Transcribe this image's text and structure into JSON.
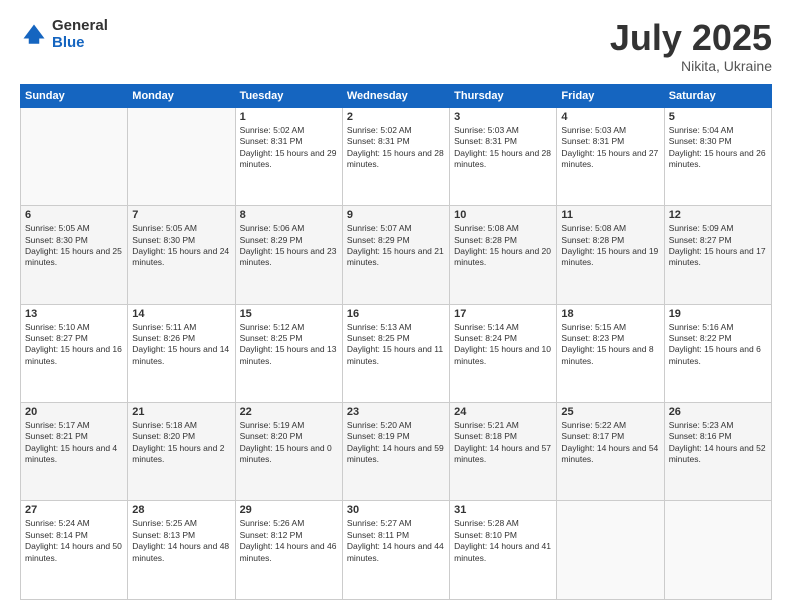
{
  "logo": {
    "general": "General",
    "blue": "Blue"
  },
  "header": {
    "month": "July 2025",
    "location": "Nikita, Ukraine"
  },
  "weekdays": [
    "Sunday",
    "Monday",
    "Tuesday",
    "Wednesday",
    "Thursday",
    "Friday",
    "Saturday"
  ],
  "weeks": [
    [
      {
        "day": "",
        "info": ""
      },
      {
        "day": "",
        "info": ""
      },
      {
        "day": "1",
        "info": "Sunrise: 5:02 AM\nSunset: 8:31 PM\nDaylight: 15 hours and 29 minutes."
      },
      {
        "day": "2",
        "info": "Sunrise: 5:02 AM\nSunset: 8:31 PM\nDaylight: 15 hours and 28 minutes."
      },
      {
        "day": "3",
        "info": "Sunrise: 5:03 AM\nSunset: 8:31 PM\nDaylight: 15 hours and 28 minutes."
      },
      {
        "day": "4",
        "info": "Sunrise: 5:03 AM\nSunset: 8:31 PM\nDaylight: 15 hours and 27 minutes."
      },
      {
        "day": "5",
        "info": "Sunrise: 5:04 AM\nSunset: 8:30 PM\nDaylight: 15 hours and 26 minutes."
      }
    ],
    [
      {
        "day": "6",
        "info": "Sunrise: 5:05 AM\nSunset: 8:30 PM\nDaylight: 15 hours and 25 minutes."
      },
      {
        "day": "7",
        "info": "Sunrise: 5:05 AM\nSunset: 8:30 PM\nDaylight: 15 hours and 24 minutes."
      },
      {
        "day": "8",
        "info": "Sunrise: 5:06 AM\nSunset: 8:29 PM\nDaylight: 15 hours and 23 minutes."
      },
      {
        "day": "9",
        "info": "Sunrise: 5:07 AM\nSunset: 8:29 PM\nDaylight: 15 hours and 21 minutes."
      },
      {
        "day": "10",
        "info": "Sunrise: 5:08 AM\nSunset: 8:28 PM\nDaylight: 15 hours and 20 minutes."
      },
      {
        "day": "11",
        "info": "Sunrise: 5:08 AM\nSunset: 8:28 PM\nDaylight: 15 hours and 19 minutes."
      },
      {
        "day": "12",
        "info": "Sunrise: 5:09 AM\nSunset: 8:27 PM\nDaylight: 15 hours and 17 minutes."
      }
    ],
    [
      {
        "day": "13",
        "info": "Sunrise: 5:10 AM\nSunset: 8:27 PM\nDaylight: 15 hours and 16 minutes."
      },
      {
        "day": "14",
        "info": "Sunrise: 5:11 AM\nSunset: 8:26 PM\nDaylight: 15 hours and 14 minutes."
      },
      {
        "day": "15",
        "info": "Sunrise: 5:12 AM\nSunset: 8:25 PM\nDaylight: 15 hours and 13 minutes."
      },
      {
        "day": "16",
        "info": "Sunrise: 5:13 AM\nSunset: 8:25 PM\nDaylight: 15 hours and 11 minutes."
      },
      {
        "day": "17",
        "info": "Sunrise: 5:14 AM\nSunset: 8:24 PM\nDaylight: 15 hours and 10 minutes."
      },
      {
        "day": "18",
        "info": "Sunrise: 5:15 AM\nSunset: 8:23 PM\nDaylight: 15 hours and 8 minutes."
      },
      {
        "day": "19",
        "info": "Sunrise: 5:16 AM\nSunset: 8:22 PM\nDaylight: 15 hours and 6 minutes."
      }
    ],
    [
      {
        "day": "20",
        "info": "Sunrise: 5:17 AM\nSunset: 8:21 PM\nDaylight: 15 hours and 4 minutes."
      },
      {
        "day": "21",
        "info": "Sunrise: 5:18 AM\nSunset: 8:20 PM\nDaylight: 15 hours and 2 minutes."
      },
      {
        "day": "22",
        "info": "Sunrise: 5:19 AM\nSunset: 8:20 PM\nDaylight: 15 hours and 0 minutes."
      },
      {
        "day": "23",
        "info": "Sunrise: 5:20 AM\nSunset: 8:19 PM\nDaylight: 14 hours and 59 minutes."
      },
      {
        "day": "24",
        "info": "Sunrise: 5:21 AM\nSunset: 8:18 PM\nDaylight: 14 hours and 57 minutes."
      },
      {
        "day": "25",
        "info": "Sunrise: 5:22 AM\nSunset: 8:17 PM\nDaylight: 14 hours and 54 minutes."
      },
      {
        "day": "26",
        "info": "Sunrise: 5:23 AM\nSunset: 8:16 PM\nDaylight: 14 hours and 52 minutes."
      }
    ],
    [
      {
        "day": "27",
        "info": "Sunrise: 5:24 AM\nSunset: 8:14 PM\nDaylight: 14 hours and 50 minutes."
      },
      {
        "day": "28",
        "info": "Sunrise: 5:25 AM\nSunset: 8:13 PM\nDaylight: 14 hours and 48 minutes."
      },
      {
        "day": "29",
        "info": "Sunrise: 5:26 AM\nSunset: 8:12 PM\nDaylight: 14 hours and 46 minutes."
      },
      {
        "day": "30",
        "info": "Sunrise: 5:27 AM\nSunset: 8:11 PM\nDaylight: 14 hours and 44 minutes."
      },
      {
        "day": "31",
        "info": "Sunrise: 5:28 AM\nSunset: 8:10 PM\nDaylight: 14 hours and 41 minutes."
      },
      {
        "day": "",
        "info": ""
      },
      {
        "day": "",
        "info": ""
      }
    ]
  ]
}
